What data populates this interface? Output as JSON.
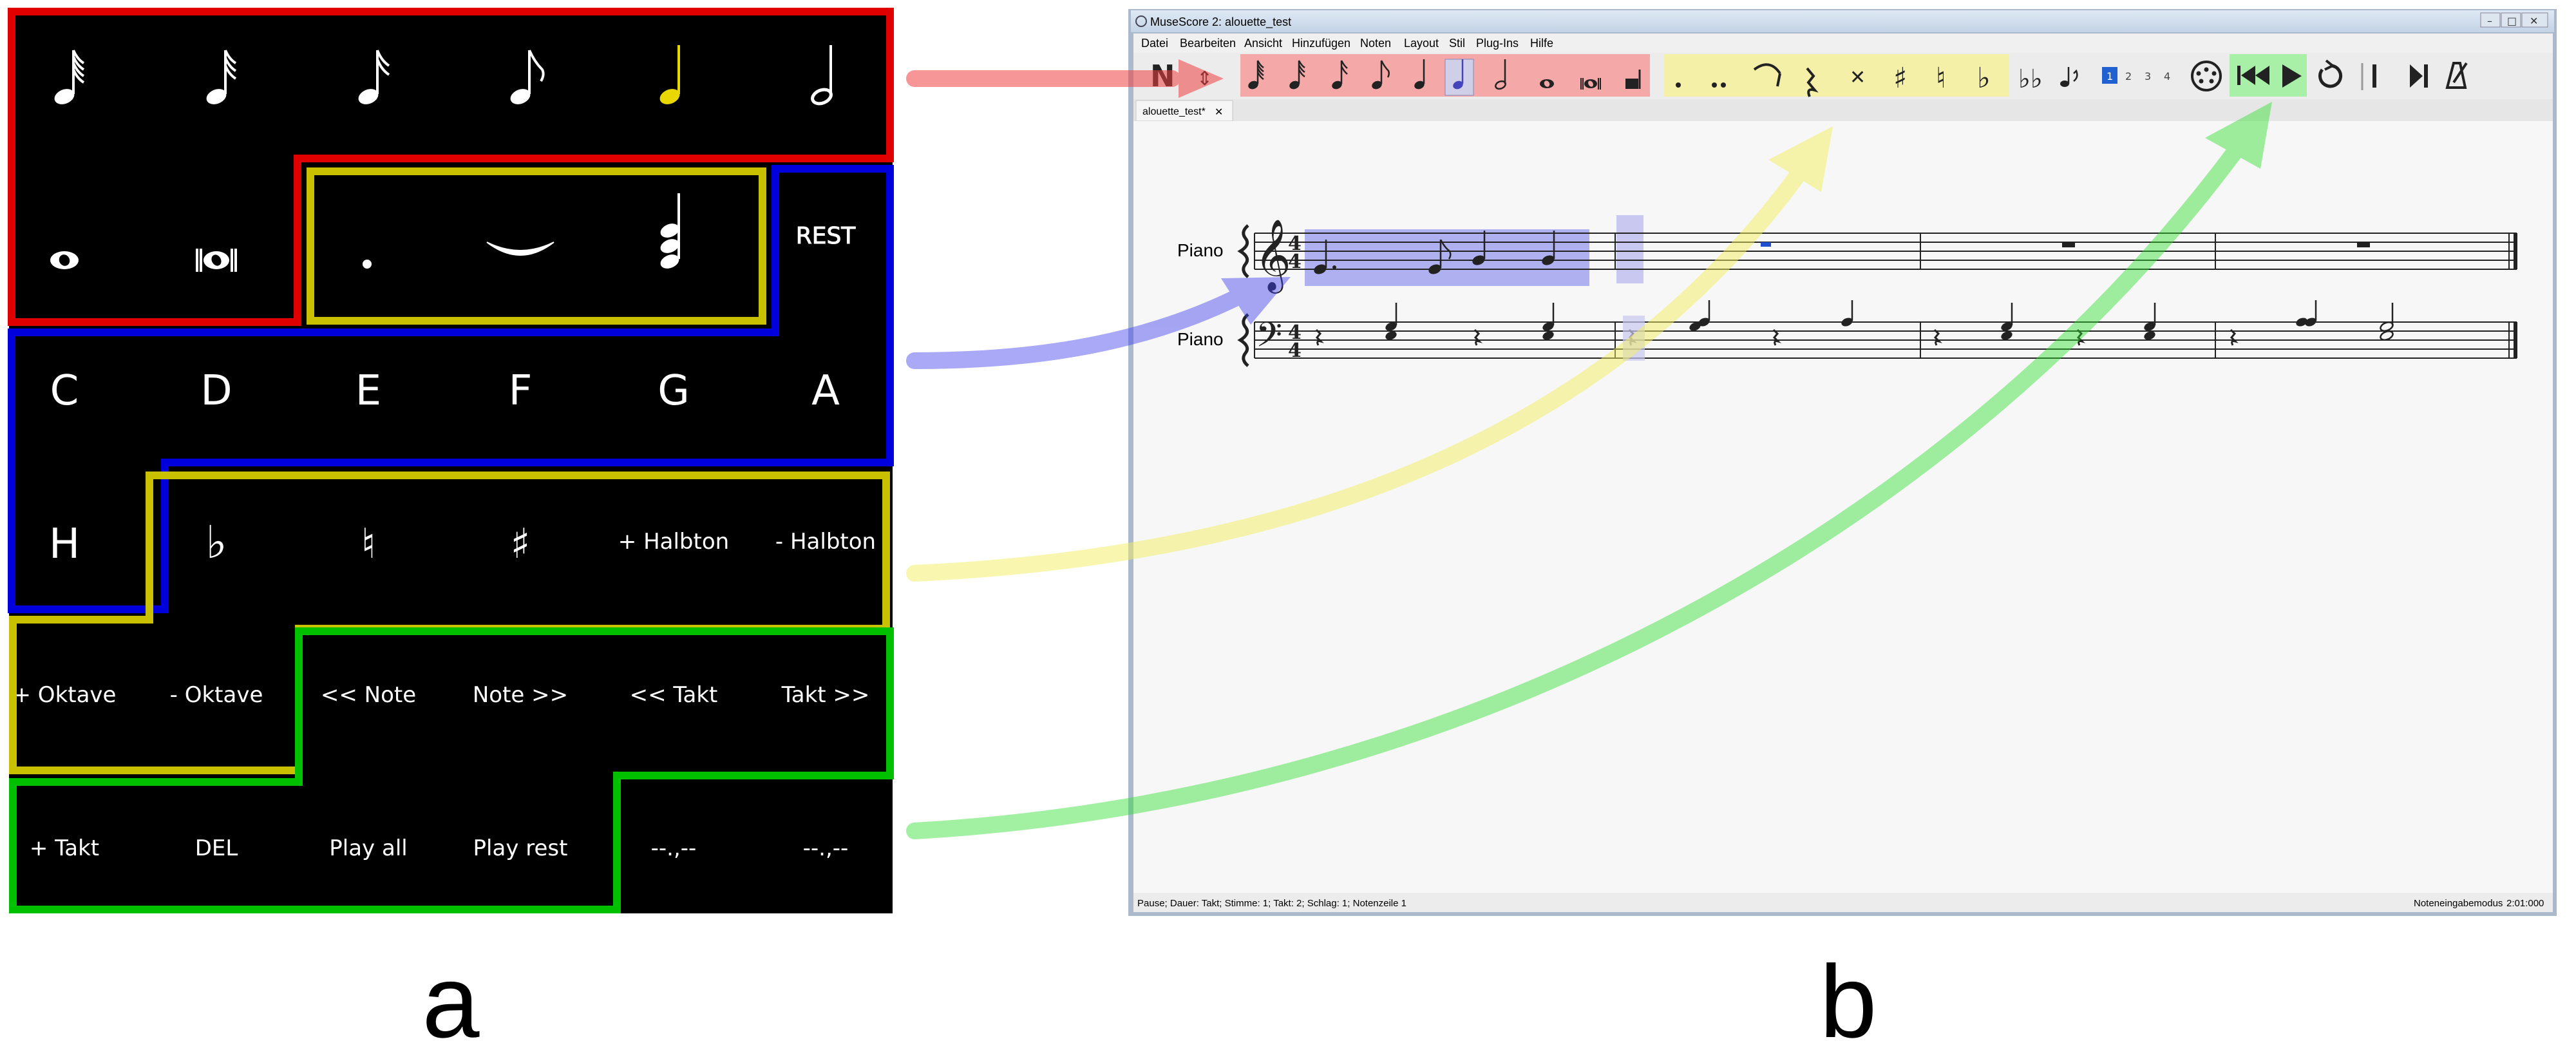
{
  "panel_labels": {
    "left": "a",
    "right": "b"
  },
  "colors": {
    "red": "#e00000",
    "blue": "#0000dd",
    "yellow": "#c8c000",
    "green": "#00c000",
    "grid_bg": "#000000",
    "sel_note": "#e8d800",
    "hl_red": "#f4a8a8",
    "hl_yellow": "#f4f0a8",
    "hl_green": "#a8f0a8",
    "hl_blue": "#aeb0f0"
  },
  "grid": {
    "row1": [
      {
        "name": "sixtyfourth-note-icon"
      },
      {
        "name": "thirtysecond-note-icon"
      },
      {
        "name": "sixteenth-note-icon"
      },
      {
        "name": "eighth-note-icon"
      },
      {
        "name": "quarter-note-icon",
        "selected": true
      },
      {
        "name": "half-note-icon"
      }
    ],
    "row2": [
      {
        "name": "whole-note-icon"
      },
      {
        "name": "breve-note-icon"
      },
      {
        "name": "augmentation-dot-icon"
      },
      {
        "name": "tie-icon"
      },
      {
        "name": "chord-icon"
      },
      {
        "name": "rest-button",
        "label": "REST"
      }
    ],
    "row3": [
      "C",
      "D",
      "E",
      "F",
      "G",
      "A"
    ],
    "row4": [
      "H",
      "♭",
      "♮",
      "♯",
      "+ Halbton",
      "- Halbton"
    ],
    "row5": [
      "+ Oktave",
      "- Oktave",
      "<< Note",
      "Note >>",
      "<< Takt",
      "Takt >>"
    ],
    "row6": [
      "+ Takt",
      "DEL",
      "Play all",
      "Play rest",
      "--.,--",
      "--.,--"
    ]
  },
  "window": {
    "title": "MuseScore 2: alouette_test",
    "menu": [
      "Datei",
      "Bearbeiten",
      "Ansicht",
      "Hinzufügen",
      "Noten",
      "Layout",
      "Stil",
      "Plug-Ins",
      "Hilfe"
    ],
    "tab_label": "alouette_test*",
    "tab_close": "✕",
    "voices": [
      "1",
      "2",
      "3",
      "4"
    ],
    "instruments": [
      "Piano",
      "Piano"
    ],
    "status_left": "Pause; Dauer: Takt; Stimme: 1;  Takt: 2; Schlag: 1; Notenzeile 1",
    "status_mode": "Noteneingabemodus",
    "status_time": "2:01:000"
  },
  "toolbar": {
    "buttons": [
      "note-input-icon",
      "note-input-dropdown-icon",
      "sixtyfourth-icon",
      "thirtysecond-icon",
      "sixteenth-icon",
      "eighth-icon",
      "quarter-icon",
      "half-icon",
      "whole-icon",
      "breve-icon",
      "longa-icon",
      "dot-icon",
      "double-dot-icon",
      "tie-icon",
      "rest-icon",
      "double-sharp-icon",
      "sharp-icon",
      "natural-icon",
      "flat-icon",
      "double-flat-icon",
      "flip-icon",
      "voice-1",
      "voice-2",
      "voice-3",
      "voice-4",
      "midi-input-icon",
      "rewind-icon",
      "play-icon",
      "loop-icon",
      "loop-in-icon",
      "loop-out-icon",
      "metronome-icon"
    ]
  }
}
